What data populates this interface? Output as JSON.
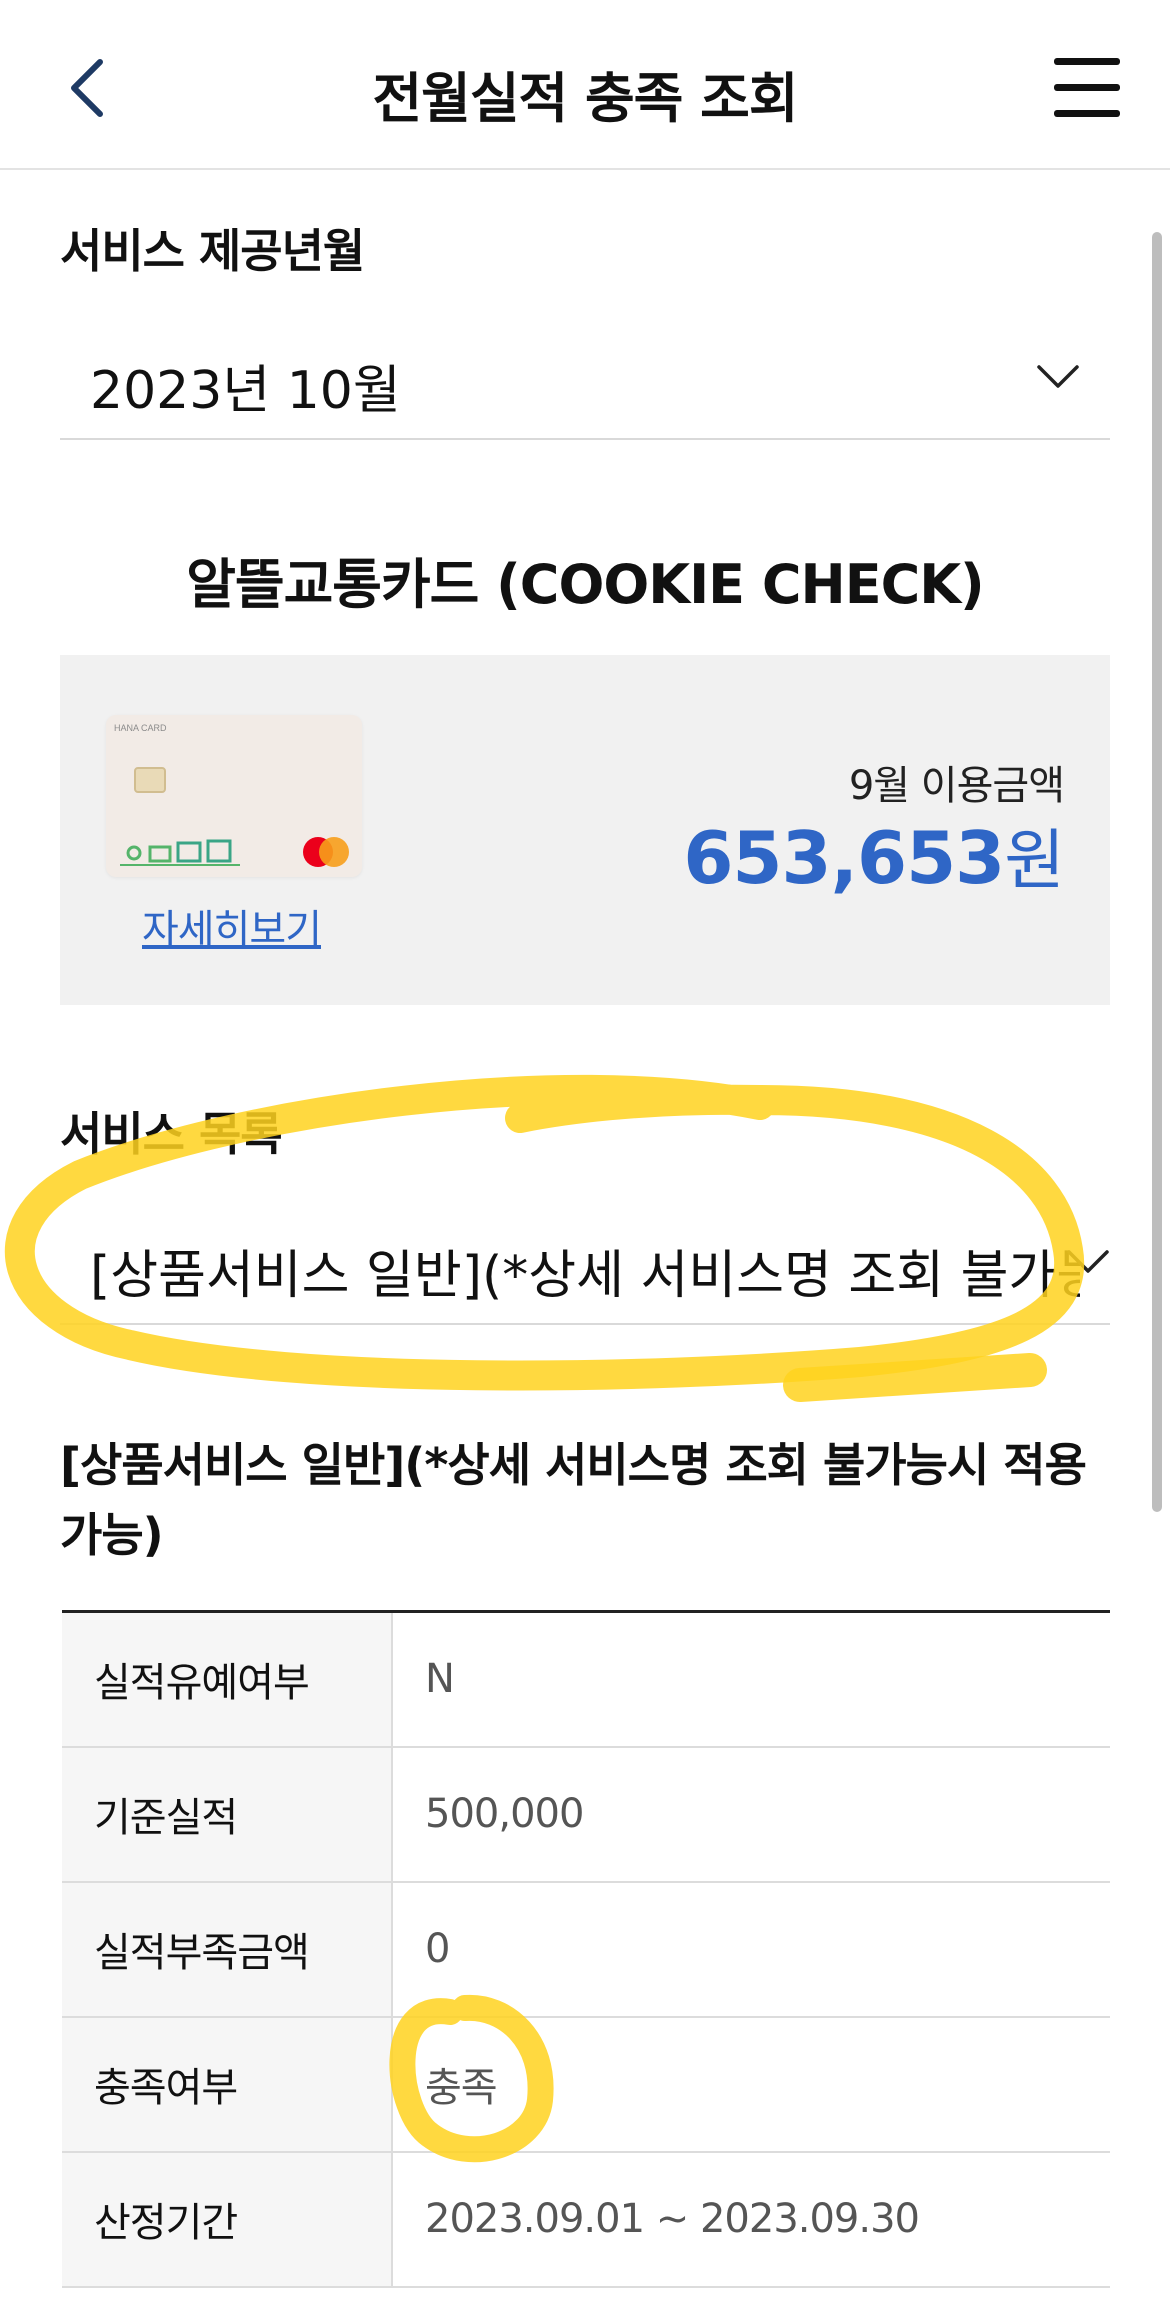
{
  "header": {
    "title": "전월실적 충족 조회"
  },
  "service_month": {
    "label": "서비스 제공년월",
    "value": "2023년 10월"
  },
  "card": {
    "title": "알뜰교통카드 (COOKIE CHECK)",
    "image_label": "HANA CARD",
    "detail_link": "자세히보기",
    "usage_label": "9월 이용금액",
    "usage_amount": "653,653",
    "usage_unit": "원"
  },
  "service_list": {
    "label": "서비스 목록",
    "selected": "[상품서비스 일반](*상세 서비스명 조회 불가능시 적용가능)"
  },
  "service_detail": {
    "heading": "[상품서비스 일반](*상세 서비스명 조회 불가능시 적용가능)",
    "rows": [
      {
        "label": "실적유예여부",
        "value": "N"
      },
      {
        "label": "기준실적",
        "value": "500,000"
      },
      {
        "label": "실적부족금액",
        "value": "0"
      },
      {
        "label": "충족여부",
        "value": "충족"
      },
      {
        "label": "산정기간",
        "value": "2023.09.01 ~ 2023.09.30"
      }
    ]
  },
  "colors": {
    "accent": "#2f66c6",
    "highlighter": "#ffd21f"
  },
  "icons": [
    "back-arrow-icon",
    "hamburger-menu-icon",
    "chevron-down-icon",
    "mastercard-logo-icon"
  ]
}
